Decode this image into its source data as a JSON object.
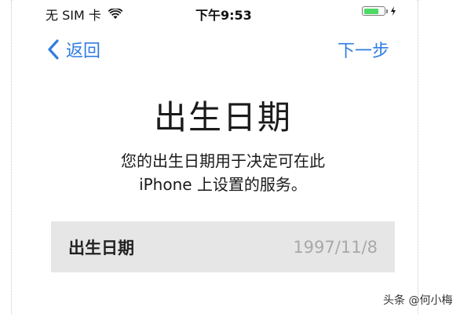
{
  "status_bar": {
    "carrier": "无 SIM 卡",
    "time": "下午9:53",
    "battery_level": 0.75,
    "battery_color": "#4cd964",
    "icons": [
      "wifi-icon",
      "battery-icon",
      "charging-bolt-icon"
    ]
  },
  "nav": {
    "back_label": "返回",
    "next_label": "下一步",
    "accent_color": "#2f7de1"
  },
  "page": {
    "title": "出生日期",
    "description_line1": "您的出生日期用于决定可在此",
    "description_line2": "iPhone 上设置的服务。"
  },
  "birthdate_row": {
    "label": "出生日期",
    "value": "1997/11/8"
  },
  "watermark": "头条 @何小梅"
}
